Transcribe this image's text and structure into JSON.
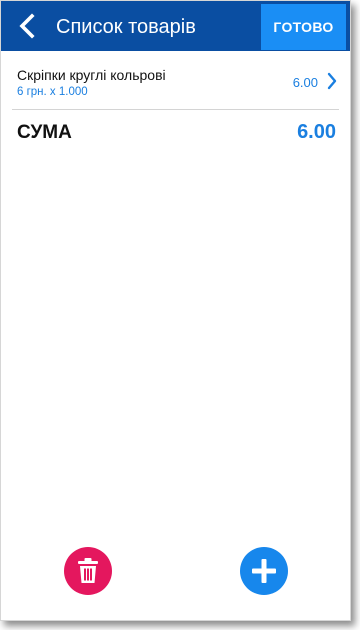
{
  "header": {
    "title": "Список товарів",
    "done_label": "ГОТОВО",
    "back_icon": "chevron-left-icon"
  },
  "items": [
    {
      "name": "Скріпки круглі кольрові",
      "detail": "6 грн. x 1.000",
      "price": "6.00",
      "icon": "chevron-right-icon"
    }
  ],
  "total": {
    "label": "СУМА",
    "value": "6.00"
  },
  "actions": {
    "delete_icon": "trash-icon",
    "add_icon": "plus-icon"
  },
  "colors": {
    "appbar": "#0a4ea2",
    "done_button": "#1a8ef5",
    "accent_text": "#1a7fe0",
    "delete_fab": "#e4175e",
    "add_fab": "#1787ec"
  }
}
